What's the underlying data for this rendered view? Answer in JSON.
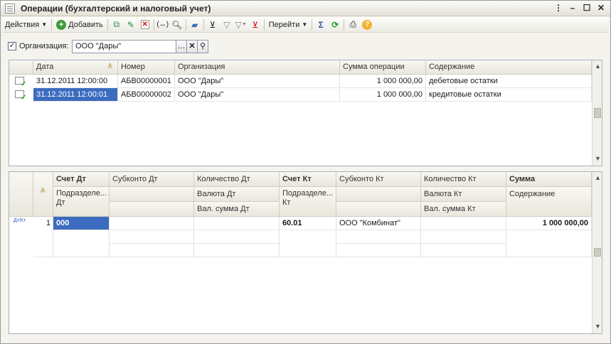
{
  "window": {
    "title": "Операции (бухгалтерский и налоговый учет)"
  },
  "toolbar": {
    "actions_label": "Действия",
    "add_label": "Добавить",
    "goto_label": "Перейти"
  },
  "filter": {
    "org_label": "Организация:",
    "org_value": "ООО \"Дары\"",
    "org_checked": true
  },
  "ops_table": {
    "headers": [
      "Дата",
      "Номер",
      "Организация",
      "Сумма операции",
      "Содержание"
    ],
    "rows": [
      {
        "date": "31.12.2011 12:00:00",
        "number": "АБВ00000001",
        "org": "ООО \"Дары\"",
        "amount": "1 000 000,00",
        "content": "дебетовые остатки"
      },
      {
        "date": "31.12.2011 12:00:01",
        "number": "АБВ00000002",
        "org": "ООО \"Дары\"",
        "amount": "1 000 000,00",
        "content": "кредитовые остатки"
      }
    ]
  },
  "entries_table": {
    "h1": [
      "Счет Дт",
      "Субконто Дт",
      "Количество Дт",
      "Счет Кт",
      "Субконто Кт",
      "Количество Кт",
      "Сумма"
    ],
    "h2": [
      "Подразделе... Дт",
      "",
      "Валюта Дт",
      "Подразделе... Кт",
      "",
      "Валюта Кт",
      "Содержание"
    ],
    "h3": [
      "",
      "",
      "Вал. сумма Дт",
      "",
      "",
      "Вал. сумма Кт",
      ""
    ],
    "row_icon": "Дт/Кт",
    "row": {
      "n": "1",
      "acc_dt": "000",
      "acc_kt": "60.01",
      "subconto_kt": "ООО \"Комбинат\"",
      "sum": "1 000 000,00"
    }
  }
}
